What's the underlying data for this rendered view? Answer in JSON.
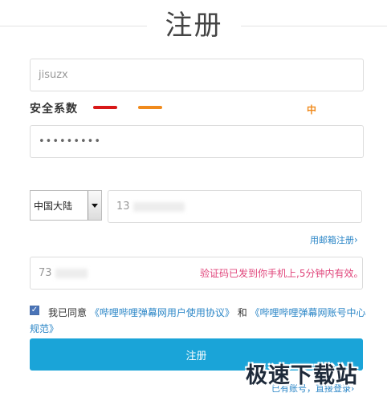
{
  "header": {
    "title": "注册"
  },
  "form": {
    "username_value": "jisuzx",
    "password_value": "•••••••••",
    "strength_label": "安全系数",
    "strength_level": "中",
    "region_value": "中国大陆",
    "phone_prefix": "13",
    "email_register_label": "用邮箱注册",
    "code_value_prefix": "73",
    "code_message": "验证码已发到你手机上,5分钟内有效。",
    "agree_text": "我已同意",
    "agreement_link1": "《哔哩哔哩弹幕网用户使用协议》",
    "agree_and": "和",
    "agreement_link2_part1": "《哔哩哔哩弹幕网账号中心",
    "agreement_link2_part2": "规范》",
    "submit_label": "注册",
    "has_account_text": "已有账号，直接登录",
    "has_account_arrow": "›"
  },
  "watermark": {
    "text": "极速下载站"
  },
  "colors": {
    "primary": "#1aa4d8",
    "link": "#2b86c7",
    "strength_weak": "#d81818",
    "strength_mid": "#f08a1c",
    "message": "#e0457b"
  },
  "icons": {
    "dropdown": "chevron-down-icon",
    "checkbox": "checkmark-icon",
    "chevron_right": "chevron-right-icon"
  }
}
